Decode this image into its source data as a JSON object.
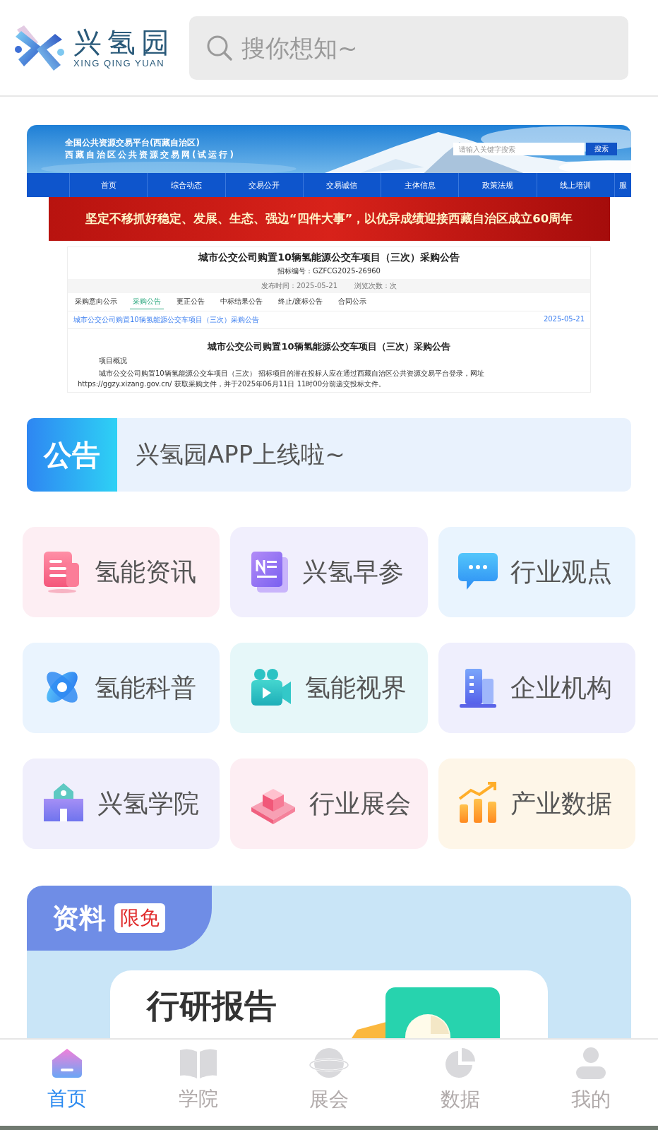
{
  "header": {
    "logo_text": "兴氢园",
    "logo_subtitle": "XING QING YUAN",
    "search": {
      "placeholder": "搜你想知~"
    }
  },
  "banner": {
    "site_title": "全国公共资源交易平台(西藏自治区)",
    "site_subtitle": "西藏自治区公共资源交易网(试运行)",
    "site_search": {
      "placeholder": "请输入关键字搜索",
      "button": "搜索"
    },
    "nav": [
      "首页",
      "综合动态",
      "交易公开",
      "交易诚信",
      "主体信息",
      "政策法规",
      "线上培训",
      "服"
    ],
    "slogan": "坚定不移抓好稳定、发展、生态、强边“四件大事”，以优异成绩迎接西藏自治区成立60周年",
    "document": {
      "title": "城市公交公司购置10辆氢能源公交车项目（三次）采购公告",
      "number": "招标编号：GZFCG2025-26960",
      "published": "发布时间：2025-05-21",
      "views": "浏览次数：次",
      "tabs": [
        {
          "label": "采购意向公示",
          "selected": false
        },
        {
          "label": "采购公告",
          "selected": true
        },
        {
          "label": "更正公告",
          "selected": false
        },
        {
          "label": "中标结果公告",
          "selected": false
        },
        {
          "label": "终止/废标公告",
          "selected": false
        },
        {
          "label": "合同公示",
          "selected": false
        }
      ],
      "link": {
        "title": "城市公交公司购置10辆氢能源公交车项目（三次）采购公告",
        "date": "2025-05-21"
      },
      "heading": "城市公交公司购置10辆氢能源公交车项目（三次）采购公告",
      "section": "项目概况",
      "body": "城市公交公司购置10辆氢能源公交车项目（三次） 招标项目的潜在投标人应在通过西藏自治区公共资源交易平台登录，网址 https://ggzy.xizang.gov.cn/ 获取采购文件，并于2025年06月11日 11时00分前递交投标文件。"
    }
  },
  "notice": {
    "label": "公告",
    "text": "兴氢园APP上线啦~"
  },
  "categories": [
    {
      "label": "氢能资讯",
      "color": "#fdeef3"
    },
    {
      "label": "兴氢早参",
      "color": "#f1effd"
    },
    {
      "label": "行业观点",
      "color": "#e9f4fe"
    },
    {
      "label": "氢能科普",
      "color": "#eaf4fe"
    },
    {
      "label": "氢能视界",
      "color": "#e6f7f9"
    },
    {
      "label": "企业机构",
      "color": "#efeffd"
    },
    {
      "label": "兴氢学院",
      "color": "#f0effc"
    },
    {
      "label": "行业展会",
      "color": "#fdeef3"
    },
    {
      "label": "产业数据",
      "color": "#fef6e8"
    }
  ],
  "resources": {
    "title": "资料",
    "badge": "限免",
    "card_title": "行研报告"
  },
  "tabbar": [
    {
      "label": "首页",
      "selected": true
    },
    {
      "label": "学院",
      "selected": false
    },
    {
      "label": "展会",
      "selected": false
    },
    {
      "label": "数据",
      "selected": false
    },
    {
      "label": "我的",
      "selected": false
    }
  ]
}
